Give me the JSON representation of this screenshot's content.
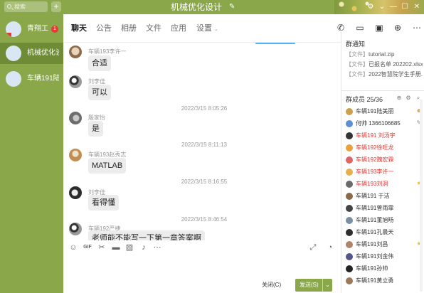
{
  "titlebar": {
    "search_placeholder": "搜索",
    "plus": "+",
    "title": "机械优化设计",
    "edit_icon": "pencil-icon",
    "controls": [
      "⚙",
      "⌄",
      "—",
      "☐",
      "✕"
    ]
  },
  "sidebar": {
    "items": [
      {
        "name": "青翔工",
        "badge": "1",
        "active": false
      },
      {
        "name": "机械优化设计",
        "badge": "",
        "active": true
      },
      {
        "name": "车辆191陆",
        "badge": "",
        "active": false
      }
    ]
  },
  "tabs": {
    "items": [
      "聊天",
      "公告",
      "相册",
      "文件",
      "应用",
      "设置"
    ],
    "chevron": "⌄"
  },
  "toolbar_icons": [
    "phone-icon",
    "video-icon",
    "screen-share-icon",
    "add-icon",
    "more-icon"
  ],
  "chat": {
    "messages": [
      {
        "kind": "msg",
        "sender": "车辆193李许一",
        "text": "合适"
      },
      {
        "kind": "msg",
        "sender": "刘李佳",
        "text": "可以"
      },
      {
        "kind": "time",
        "text": "2022/3/15 8:05:26"
      },
      {
        "kind": "msg",
        "sender": "殷家怡",
        "text": "是"
      },
      {
        "kind": "time",
        "text": "2022/3/15 8:11:13"
      },
      {
        "kind": "msg",
        "sender": "车辆193赵秀志",
        "text": "MATLAB"
      },
      {
        "kind": "time",
        "text": "2022/3/15 8:16:55"
      },
      {
        "kind": "msg",
        "sender": "刘李佳",
        "text": "看得懂"
      },
      {
        "kind": "time",
        "text": "2022/3/15 8:46:54"
      },
      {
        "kind": "msg",
        "sender": "车辆192严捷",
        "text": "老师能不能写一下第一章答案啊"
      }
    ]
  },
  "inputbar": {
    "icons": [
      "emoji-icon",
      "gif-icon",
      "scissors-icon",
      "folder-icon",
      "image-icon",
      "bell-icon",
      "more-dots-icon",
      "expand-icon",
      "history-icon"
    ]
  },
  "footer": {
    "close_label": "关闭(C)",
    "send_label": "发送(S)",
    "send_arrow": "⌄"
  },
  "notice": {
    "title": "群通知",
    "lines": [
      {
        "prefix": "【文件】",
        "text": "tutorial.zip"
      },
      {
        "prefix": "【文件】",
        "text": "已报名单 202202.xlsx"
      },
      {
        "prefix": "【文件】",
        "text": "2022智慧院学生手册.p..."
      }
    ]
  },
  "members": {
    "title": "群成员 25/36",
    "list": [
      {
        "name": "车辆191陆美丽",
        "red": false,
        "role": "owner-icon"
      },
      {
        "name": "何帅 1366106685",
        "red": false,
        "role": "edit-icon"
      },
      {
        "name": "车辆191 刘汤宇",
        "red": true,
        "role": ""
      },
      {
        "name": "车辆192徐旺龙",
        "red": true,
        "role": ""
      },
      {
        "name": "车辆192魏宏霖",
        "red": true,
        "role": ""
      },
      {
        "name": "车辆193李许一",
        "red": true,
        "role": ""
      },
      {
        "name": "车辆193刘洞",
        "red": true,
        "role": "star-icon"
      },
      {
        "name": "车辆191 于洁",
        "red": false,
        "role": ""
      },
      {
        "name": "车辆191曾雨霏",
        "red": false,
        "role": ""
      },
      {
        "name": "车辆191董旭旸",
        "red": false,
        "role": ""
      },
      {
        "name": "车辆191孔晨天",
        "red": false,
        "role": ""
      },
      {
        "name": "车辆191刘昌",
        "red": false,
        "role": "star-icon"
      },
      {
        "name": "车辆191刘金伟",
        "red": false,
        "role": ""
      },
      {
        "name": "车辆191孙帅",
        "red": false,
        "role": ""
      },
      {
        "name": "车辆191黄立勇",
        "red": false,
        "role": ""
      }
    ]
  },
  "colors": {
    "accent": "#8aa84a",
    "sidebar_active": "#6e8c35",
    "badge": "#e53935",
    "admin_red": "#e53935"
  }
}
